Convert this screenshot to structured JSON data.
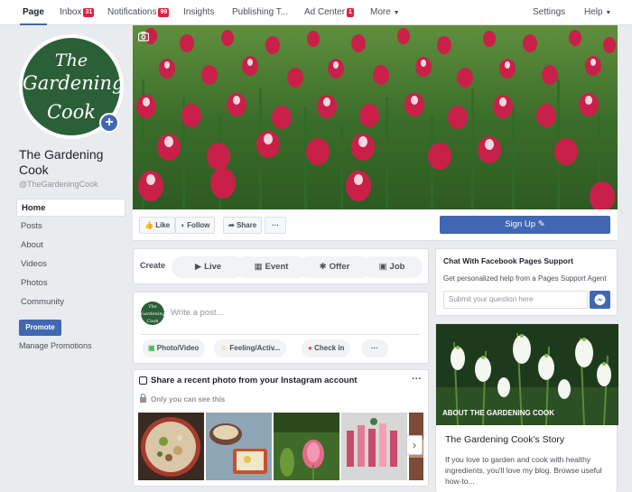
{
  "topnav": {
    "page": "Page",
    "inbox": "Inbox",
    "inbox_count": "31",
    "notifications": "Notifications",
    "notifications_count": "99",
    "insights": "Insights",
    "publishing": "Publishing T...",
    "ad_center": "Ad Center",
    "ad_center_count": "1",
    "more": "More",
    "settings": "Settings",
    "help": "Help"
  },
  "profile": {
    "logo_line1": "The",
    "logo_line2": "Gardening",
    "logo_line3": "Cook",
    "name": "The Gardening Cook",
    "handle": "@TheGardeningCook"
  },
  "sidebar": {
    "items": [
      {
        "label": "Home"
      },
      {
        "label": "Posts"
      },
      {
        "label": "About"
      },
      {
        "label": "Videos"
      },
      {
        "label": "Photos"
      },
      {
        "label": "Community"
      }
    ],
    "promote": "Promote",
    "manage_promotions": "Manage Promotions"
  },
  "actions": {
    "like": "Like",
    "follow": "Follow",
    "share": "Share",
    "more": "···",
    "signup": "Sign Up"
  },
  "create": {
    "label": "Create",
    "live": "Live",
    "event": "Event",
    "offer": "Offer",
    "job": "Job"
  },
  "write_post": {
    "placeholder": "Write a post...",
    "photo_video": "Photo/Video",
    "feeling": "Feeling/Activ...",
    "check_in": "Check in",
    "more": "···"
  },
  "instagram": {
    "title": "Share a recent photo from your Instagram account",
    "visibility": "Only you can see this",
    "menu": "···"
  },
  "chat": {
    "title": "Chat With Facebook Pages Support",
    "description": "Get personalized help from a Pages Support Agent",
    "input_placeholder": "Submit your question here"
  },
  "about": {
    "label": "ABOUT THE GARDENING COOK",
    "story_title": "The Gardening Cook's Story",
    "story_text": "If you love to garden and cook with healthy ingredients, you'll love my blog. Browse useful how-to..."
  },
  "colors": {
    "brand_blue": "#4267b2",
    "badge_red": "#e41e3f",
    "logo_green": "#2b5f37"
  }
}
